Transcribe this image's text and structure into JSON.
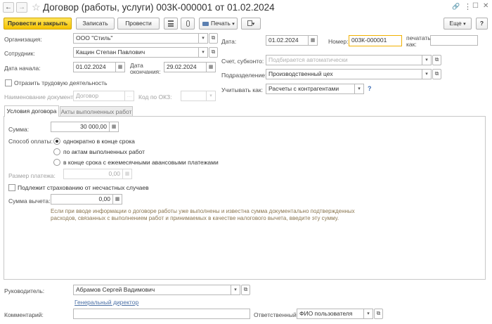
{
  "window": {
    "title": "Договор (работы, услуги) 003К-000001 от 01.02.2024",
    "back_glyph": "←",
    "forward_glyph": "→",
    "star_glyph": "☆",
    "link_glyph": "🔗",
    "menu_glyph": "⋮",
    "maximize_glyph": "☐",
    "close_glyph": "✕"
  },
  "toolbar": {
    "post_close_label": "Провести и закрыть",
    "save_label": "Записать",
    "post_label": "Провести",
    "print_label": "Печать",
    "more_label": "Еще",
    "help_label": "?",
    "dropdown_glyph": "▾"
  },
  "header": {
    "org_label": "Организация:",
    "org_value": "ООО \"Стиль\"",
    "employee_label": "Сотрудник:",
    "employee_value": "Кащин Степан Павлович",
    "start_label": "Дата начала:",
    "start_value": "01.02.2024",
    "end_label_1": "Дата",
    "end_label_2": "окончания:",
    "end_value": "29.02.2024",
    "labor_label": "Отразить трудовую деятельность",
    "docname_label": "Наименование документа:",
    "docname_value": "Договор",
    "okz_label": "Код по ОКЗ:",
    "date_label": "Дата:",
    "date_value": "01.02.2024",
    "number_label": "Номер:",
    "number_value": "003К-000001",
    "print_as_label_1": "печатать",
    "print_as_label_2": "как:",
    "print_as_value": "",
    "account_label": "Счет, субконто:",
    "account_placeholder": "Подбирается автоматически",
    "dept_label": "Подразделение:",
    "dept_value": "Производственный цех",
    "consider_label": "Учитывать как:",
    "consider_value": "Расчеты с контрагентами",
    "help_mark": "?"
  },
  "tabs": [
    {
      "label": "Условия договора",
      "active": true
    },
    {
      "label": "Акты выполненных работ",
      "active": false
    }
  ],
  "terms": {
    "sum_label": "Сумма:",
    "sum_value": "30 000,00",
    "payment_label": "Способ оплаты:",
    "payment_options": [
      {
        "label": "однократно в конце срока",
        "selected": true
      },
      {
        "label": "по актам выполненных работ",
        "selected": false
      },
      {
        "label": "в конце срока с ежемесячными авансовыми платежами",
        "selected": false
      }
    ],
    "payment_size_label": "Размер платежа:",
    "payment_size_value": "0,00",
    "insurance_label": "Подлежит страхованию от несчастных случаев",
    "deduction_label": "Сумма вычета:",
    "deduction_value": "0,00",
    "hint_line_1": "Если при вводе информации о договоре работы уже выполнены и известна сумма документально подтвержденных",
    "hint_line_2": "расходов, связанных с выполнением работ и принимаемых в качестве налогового вычета, введите эту сумму."
  },
  "footer": {
    "manager_label": "Руководитель:",
    "manager_value": "Абрамов Сергей Вадимович",
    "manager_position": "Генеральный директор",
    "comment_label": "Комментарий:",
    "comment_value": "",
    "responsible_label": "Ответственный:",
    "responsible_value": "ФИО пользователя"
  },
  "glyphs": {
    "calendar": "▦",
    "open": "⧉",
    "select": "…"
  }
}
